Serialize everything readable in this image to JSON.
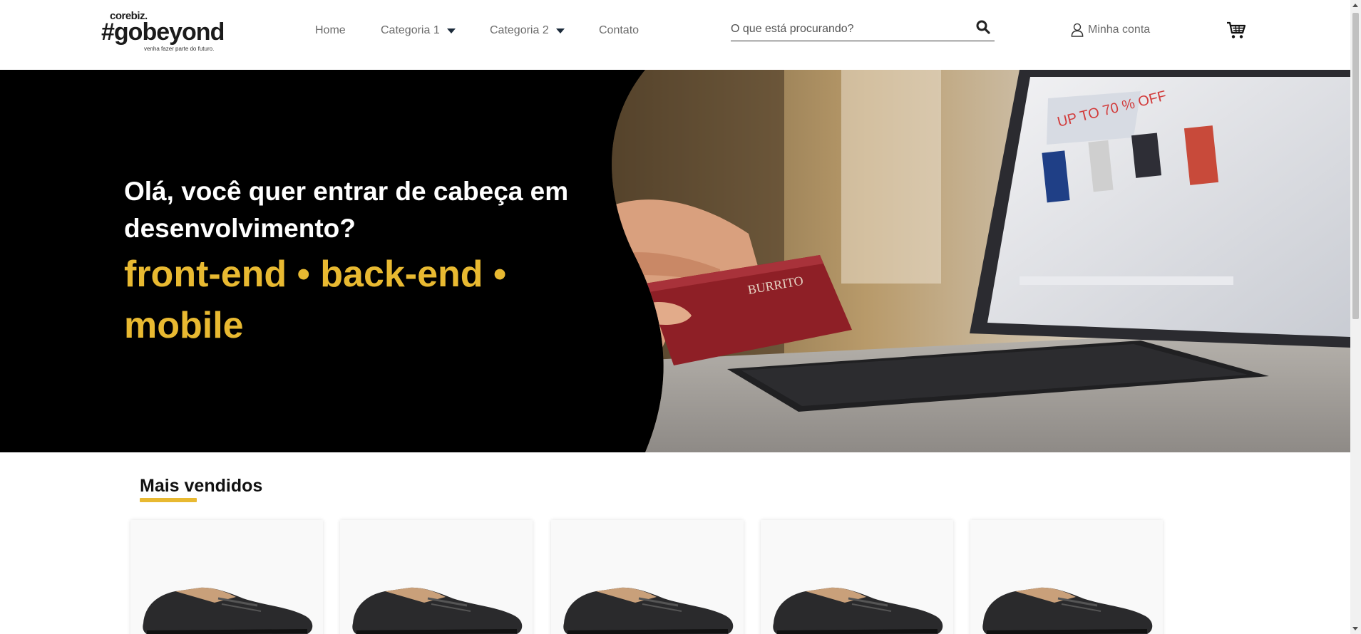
{
  "brand": {
    "company": "corebiz.",
    "name": "#gobeyond",
    "tagline": "venha fazer parte do futuro."
  },
  "nav": {
    "items": [
      {
        "label": "Home",
        "has_dropdown": false
      },
      {
        "label": "Categoria 1",
        "has_dropdown": true
      },
      {
        "label": "Categoria 2",
        "has_dropdown": true
      },
      {
        "label": "Contato",
        "has_dropdown": false
      }
    ]
  },
  "search": {
    "placeholder": "O que está procurando?",
    "icon": "search-icon"
  },
  "account": {
    "label": "Minha conta",
    "icon": "user-icon"
  },
  "cart": {
    "icon": "cart-icon"
  },
  "hero": {
    "question": "Olá, você quer entrar de cabeça em desenvolvimento?",
    "tech_line1": "front-end • back-end •",
    "tech_line2": "mobile"
  },
  "bestsellers": {
    "title": "Mais vendidos",
    "product_count": 5
  },
  "colors": {
    "accent": "#e8b931",
    "hero_bg": "#000000",
    "text_dark": "#111111",
    "nav_text": "#6b6b6b"
  }
}
